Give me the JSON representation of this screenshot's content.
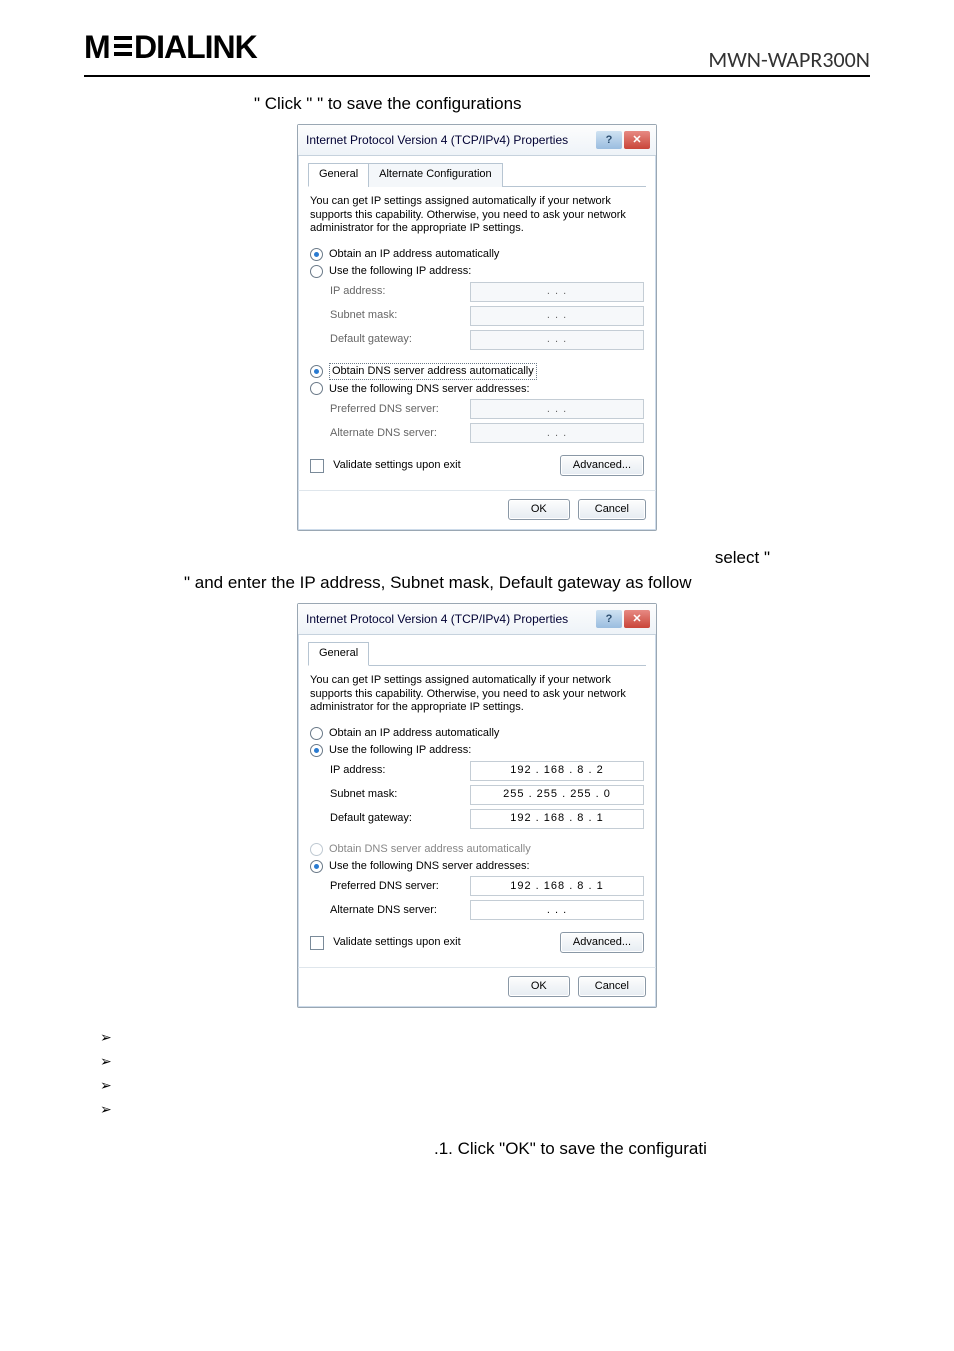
{
  "header": {
    "logo_text": "MEDIALINK",
    "model": "MWN-WAPR300N"
  },
  "text": {
    "line1": "\" Click \"     \" to save the configurations",
    "line2_right": "select \"",
    "line3": "\" and enter the IP address, Subnet mask, Default gateway as follow",
    "footer_line": ".1. Click \"OK\" to save the configurati"
  },
  "dialog_common": {
    "title": "Internet Protocol Version 4 (TCP/IPv4) Properties",
    "help_icon": "?",
    "close_icon": "✕",
    "tab_general": "General",
    "tab_alt": "Alternate Configuration",
    "desc": "You can get IP settings assigned automatically if your network supports this capability. Otherwise, you need to ask your network administrator for the appropriate IP settings.",
    "obtain_ip": "Obtain an IP address automatically",
    "use_ip": "Use the following IP address:",
    "ip_address": "IP address:",
    "subnet": "Subnet mask:",
    "gateway": "Default gateway:",
    "obtain_dns": "Obtain DNS server address automatically",
    "use_dns": "Use the following DNS server addresses:",
    "pref_dns": "Preferred DNS server:",
    "alt_dns": "Alternate DNS server:",
    "validate": "Validate settings upon exit",
    "advanced": "Advanced...",
    "ok": "OK",
    "cancel": "Cancel"
  },
  "dialog2_values": {
    "ip": "192 . 168 .  8  .  2",
    "mask": "255 . 255 . 255 .  0",
    "gw": "192 . 168 .  8  .  1",
    "pref_dns": "192 . 168 .  8  .  1",
    "alt_dns": ".       .       ."
  },
  "dots": ".       .       ."
}
